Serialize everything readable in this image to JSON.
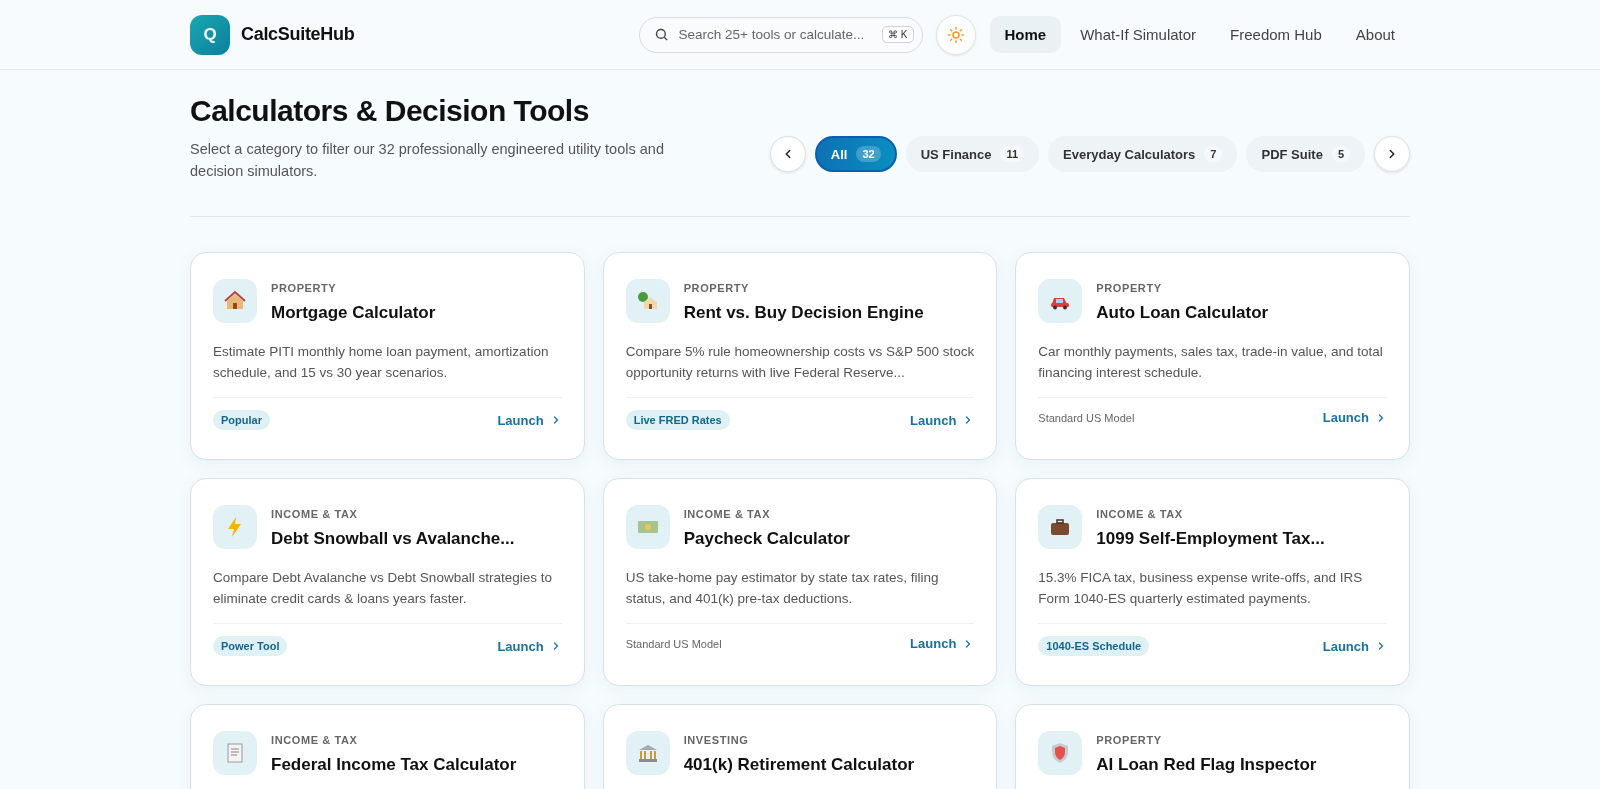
{
  "header": {
    "logo_letter": "Q",
    "brand": "CalcSuiteHub",
    "search": {
      "placeholder": "Search 25+ tools or calculate...",
      "shortcut": "⌘ K"
    },
    "nav": [
      {
        "label": "Home",
        "selected": true
      },
      {
        "label": "What-If Simulator",
        "selected": false
      },
      {
        "label": "Freedom Hub",
        "selected": false
      },
      {
        "label": "About",
        "selected": false
      }
    ]
  },
  "page": {
    "title": "Calculators & Decision Tools",
    "subtitle": "Select a category to filter our 32 professionally engineered utility tools and decision simulators.",
    "categories": [
      {
        "label": "All",
        "count": "32",
        "selected": true
      },
      {
        "label": "US Finance",
        "count": "11",
        "selected": false
      },
      {
        "label": "Everyday Calculators",
        "count": "7",
        "selected": false
      },
      {
        "label": "PDF Suite",
        "count": "5",
        "selected": false
      }
    ]
  },
  "cards": [
    {
      "category": "PROPERTY",
      "title": "Mortgage Calculator",
      "description": "Estimate PITI monthly home loan payment, amortization schedule, and 15 vs 30 year scenarios.",
      "footer": {
        "kind": "badge",
        "text": "Popular"
      },
      "action": "Launch"
    },
    {
      "category": "PROPERTY",
      "title": "Rent vs. Buy Decision Engine",
      "description": "Compare 5% rule homeownership costs vs S&P 500 stock opportunity returns with live Federal Reserve...",
      "footer": {
        "kind": "badge",
        "text": "Live FRED Rates"
      },
      "action": "Launch"
    },
    {
      "category": "PROPERTY",
      "title": "Auto Loan Calculator",
      "description": "Car monthly payments, sales tax, trade-in value, and total financing interest schedule.",
      "footer": {
        "kind": "note",
        "text": "Standard US Model"
      },
      "action": "Launch"
    },
    {
      "category": "INCOME & TAX",
      "title": "Debt Snowball vs Avalanche...",
      "description": "Compare Debt Avalanche vs Debt Snowball strategies to eliminate credit cards & loans years faster.",
      "footer": {
        "kind": "badge",
        "text": "Power Tool"
      },
      "action": "Launch"
    },
    {
      "category": "INCOME & TAX",
      "title": "Paycheck Calculator",
      "description": "US take-home pay estimator by state tax rates, filing status, and 401(k) pre-tax deductions.",
      "footer": {
        "kind": "note",
        "text": "Standard US Model"
      },
      "action": "Launch"
    },
    {
      "category": "INCOME & TAX",
      "title": "1099 Self-Employment Tax...",
      "description": "15.3% FICA tax, business expense write-offs, and IRS Form 1040-ES quarterly estimated payments.",
      "footer": {
        "kind": "badge",
        "text": "1040-ES Schedule"
      },
      "action": "Launch"
    },
    {
      "category": "INCOME & TAX",
      "title": "Federal Income Tax Calculator"
    },
    {
      "category": "INVESTING",
      "title": "401(k) Retirement Calculator"
    },
    {
      "category": "PROPERTY",
      "title": "AI Loan Red Flag Inspector"
    }
  ]
}
